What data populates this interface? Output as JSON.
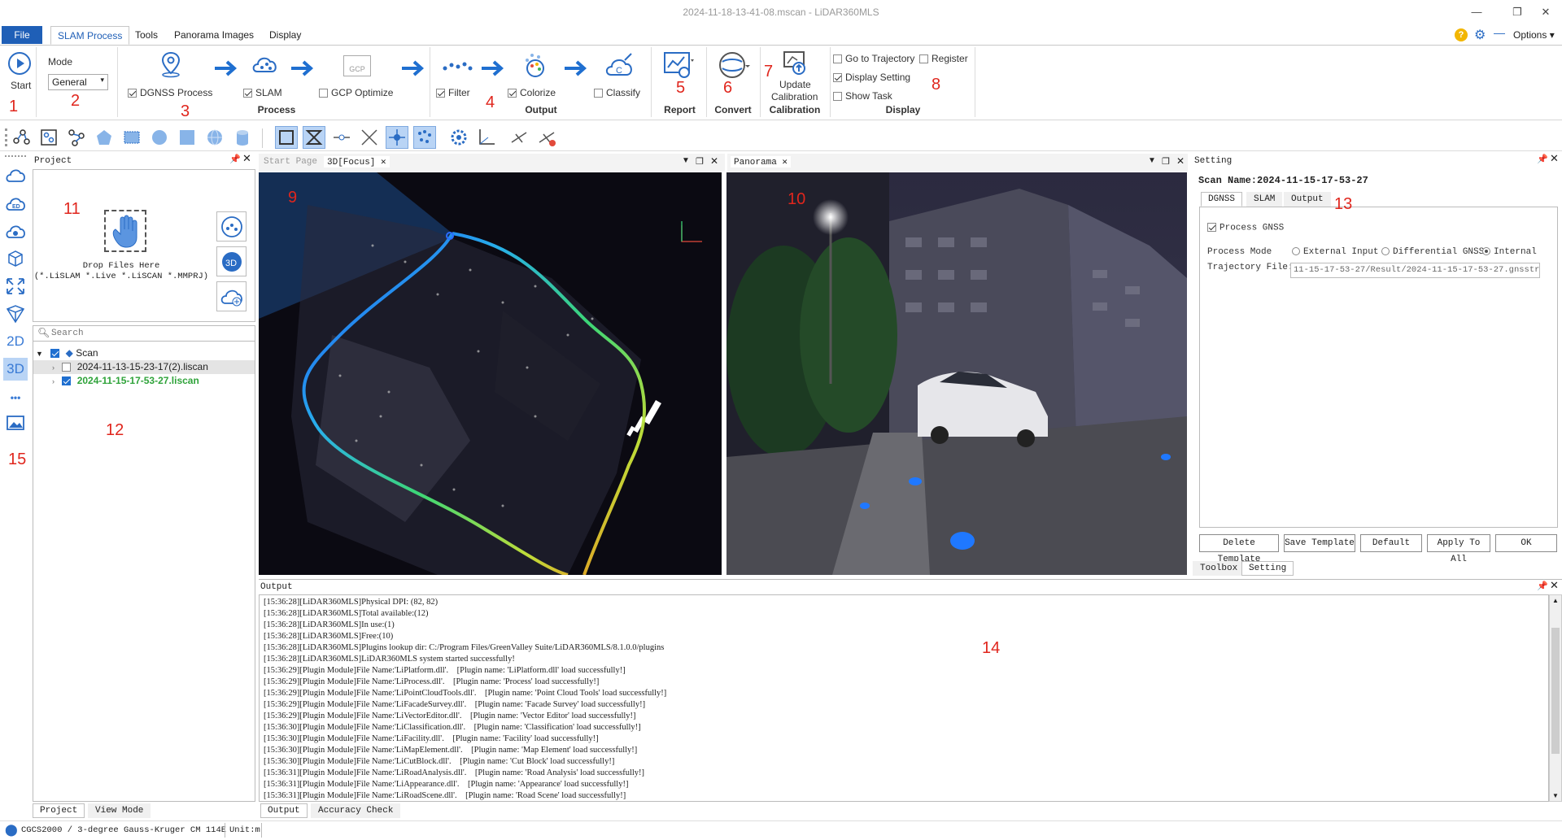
{
  "window": {
    "title": "2024-11-18-13-41-08.mscan - LiDAR360MLS",
    "options_label": "Options"
  },
  "menu": {
    "file": "File",
    "tabs": [
      "SLAM Process",
      "Tools",
      "Panorama Images",
      "Display"
    ]
  },
  "ribbon": {
    "start_label": "Start",
    "mode_label": "Mode",
    "mode_value": "General",
    "dgnss_label": "DGNSS Process",
    "slam_label": "SLAM",
    "gcp_label": "GCP Optimize",
    "gcp_icon_text": "GCP",
    "process_group": "Process",
    "filter_label": "Filter",
    "colorize_label": "Colorize",
    "classify_label": "Classify",
    "output_group": "Output",
    "report_group": "Report",
    "convert_group": "Convert",
    "update_cal_label_1": "Update",
    "update_cal_label_2": "Calibration",
    "calibration_group": "Calibration",
    "go_to_trajectory": "Go to Trajectory",
    "register": "Register",
    "display_setting": "Display Setting",
    "show_task": "Show Task",
    "display_group": "Display"
  },
  "annotations": [
    "1",
    "2",
    "3",
    "4",
    "5",
    "6",
    "7",
    "8",
    "9",
    "10",
    "11",
    "12",
    "13",
    "14",
    "15"
  ],
  "left_toolbar": {
    "btn_2d": "2D",
    "btn_3d": "3D",
    "btn_more": "•••"
  },
  "project_panel": {
    "title": "Project",
    "drop_line1": "Drop Files Here",
    "drop_line2": "(*.LiSLAM *.Live *.LiSCAN *.MMPRJ)",
    "search_placeholder": "Search",
    "tree_root": "Scan",
    "tree_item1": "2024-11-13-15-23-17(2).liscan",
    "tree_item2": "2024-11-15-17-53-27.liscan",
    "tab_project": "Project",
    "tab_view_mode": "View Mode"
  },
  "view3d": {
    "tab_start": "Start Page",
    "tab_3d": "3D[Focus]"
  },
  "panorama": {
    "tab": "Panorama"
  },
  "setting_panel": {
    "title": "Setting",
    "scan_name": "Scan Name:2024-11-15-17-53-27",
    "tabs": [
      "DGNSS",
      "SLAM",
      "Output"
    ],
    "process_gnss": "Process GNSS",
    "process_mode_label": "Process Mode",
    "mode_options": [
      "External Input",
      "Differential GNSS",
      "Internal"
    ],
    "trajectory_label": "Trajectory File:",
    "trajectory_value": "11-15-17-53-27/Result/2024-11-15-17-53-27.gnsstraj",
    "buttons": [
      "Delete Template",
      "Save Template",
      "Default",
      "Apply To All",
      "OK"
    ],
    "bottom_tabs": [
      "Toolbox",
      "Setting"
    ]
  },
  "output_panel": {
    "title": "Output",
    "lines": [
      "[15:36:28][LiDAR360MLS]Physical DPI: (82, 82)",
      "[15:36:28][LiDAR360MLS]Total available:(12)",
      "[15:36:28][LiDAR360MLS]In use:(1)",
      "[15:36:28][LiDAR360MLS]Free:(10)",
      "[15:36:28][LiDAR360MLS]Plugins lookup dir: C:/Program Files/GreenValley Suite/LiDAR360MLS/8.1.0.0/plugins",
      "[15:36:28][LiDAR360MLS]LiDAR360MLS system started successfully!",
      "[15:36:29][Plugin Module]File Name:'LiPlatform.dll'.    [Plugin name: 'LiPlatform.dll' load successfully!]",
      "[15:36:29][Plugin Module]File Name:'LiProcess.dll'.    [Plugin name: 'Process' load successfully!]",
      "[15:36:29][Plugin Module]File Name:'LiPointCloudTools.dll'.    [Plugin name: 'Point Cloud Tools' load successfully!]",
      "[15:36:29][Plugin Module]File Name:'LiFacadeSurvey.dll'.    [Plugin name: 'Facade Survey' load successfully!]",
      "[15:36:29][Plugin Module]File Name:'LiVectorEditor.dll'.    [Plugin name: 'Vector Editor' load successfully!]",
      "[15:36:30][Plugin Module]File Name:'LiClassification.dll'.    [Plugin name: 'Classification' load successfully!]",
      "[15:36:30][Plugin Module]File Name:'LiFacility.dll'.    [Plugin name: 'Facility' load successfully!]",
      "[15:36:30][Plugin Module]File Name:'LiMapElement.dll'.    [Plugin name: 'Map Element' load successfully!]",
      "[15:36:30][Plugin Module]File Name:'LiCutBlock.dll'.    [Plugin name: 'Cut Block' load successfully!]",
      "[15:36:31][Plugin Module]File Name:'LiRoadAnalysis.dll'.    [Plugin name: 'Road Analysis' load successfully!]",
      "[15:36:31][Plugin Module]File Name:'LiAppearance.dll'.    [Plugin name: 'Appearance' load successfully!]",
      "[15:36:31][Plugin Module]File Name:'LiRoadScene.dll'.    [Plugin name: 'Road Scene' load successfully!]"
    ],
    "tabs": [
      "Output",
      "Accuracy Check"
    ]
  },
  "status_bar": {
    "crs": "CGCS2000 / 3-degree Gauss-Kruger CM 114E",
    "unit": "Unit:m"
  }
}
